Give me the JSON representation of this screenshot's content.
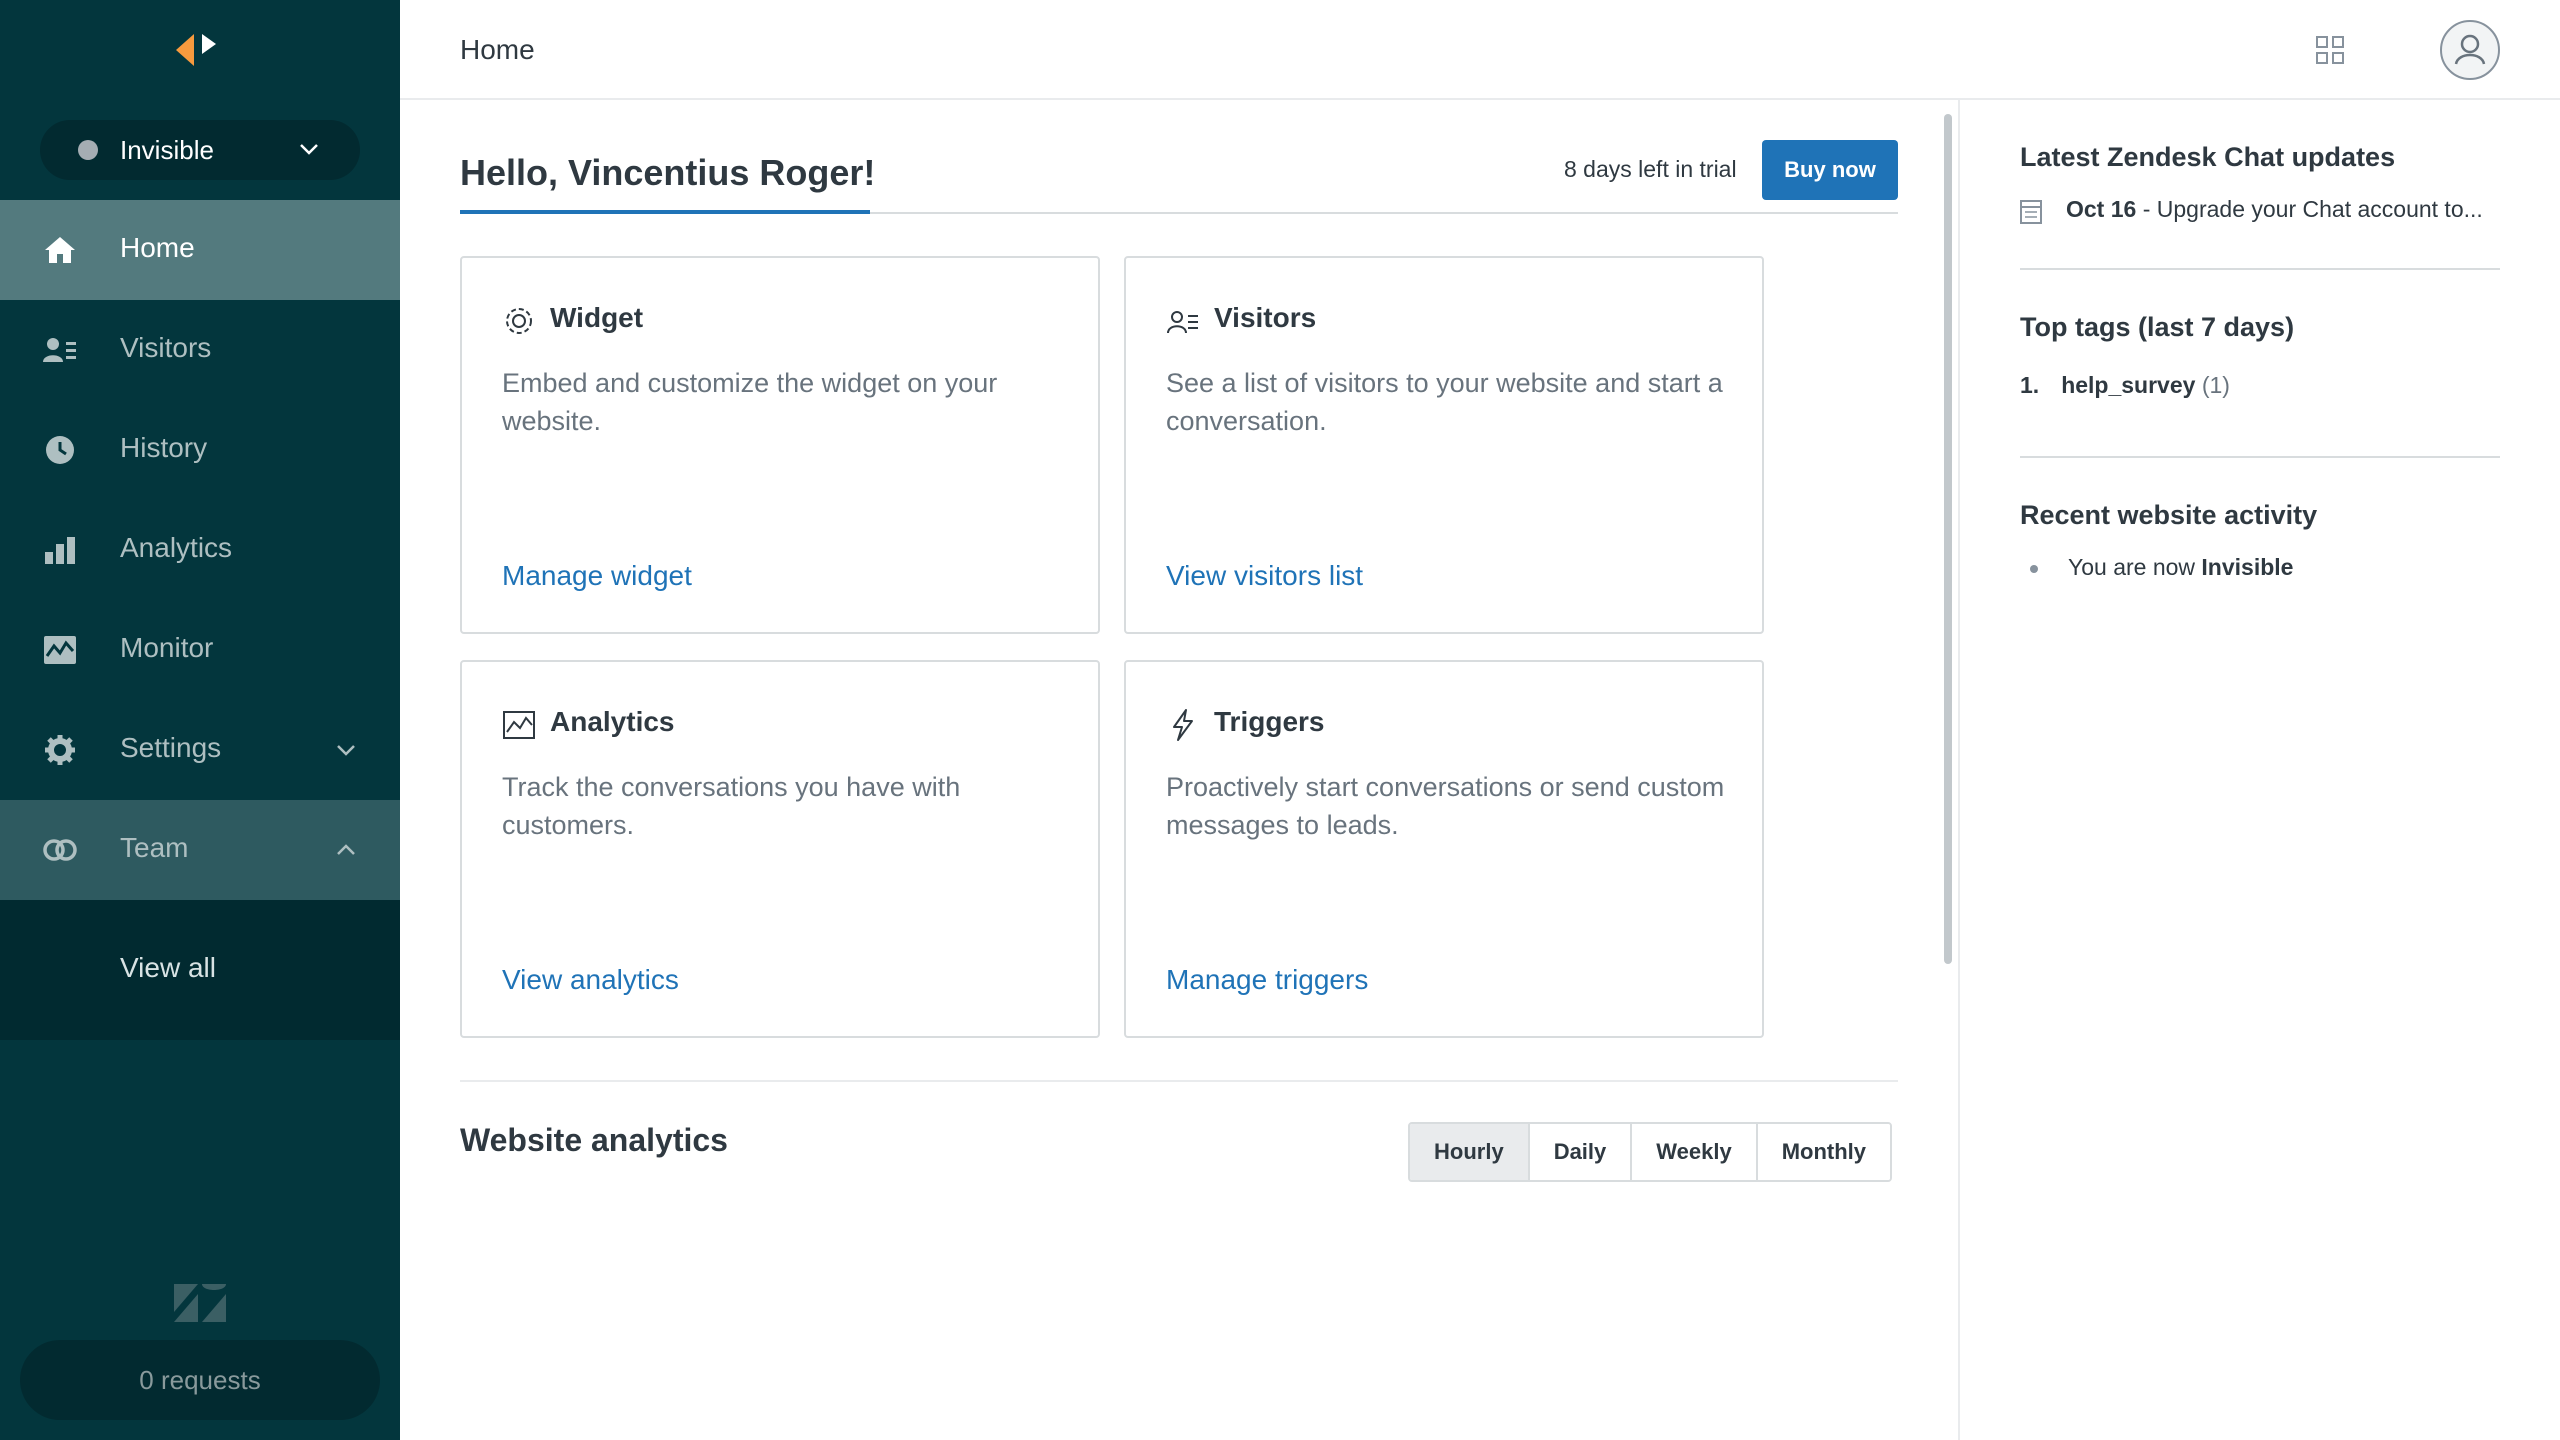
{
  "sidebar": {
    "status": "Invisible",
    "nav": [
      {
        "label": "Home",
        "icon": "home-icon"
      },
      {
        "label": "Visitors",
        "icon": "visitors-icon"
      },
      {
        "label": "History",
        "icon": "history-icon"
      },
      {
        "label": "Analytics",
        "icon": "analytics-icon"
      },
      {
        "label": "Monitor",
        "icon": "monitor-icon"
      },
      {
        "label": "Settings",
        "icon": "gear-icon"
      },
      {
        "label": "Team",
        "icon": "team-icon"
      }
    ],
    "team_sub": "View all",
    "requests": "0 requests"
  },
  "topbar": {
    "title": "Home"
  },
  "main": {
    "greeting": "Hello, Vincentius Roger!",
    "trial": "8 days left in trial",
    "buy": "Buy now",
    "cards": [
      {
        "title": "Widget",
        "desc": "Embed and customize the widget on your website.",
        "link": "Manage widget"
      },
      {
        "title": "Visitors",
        "desc": "See a list of visitors to your website and start a conversation.",
        "link": "View visitors list"
      },
      {
        "title": "Analytics",
        "desc": "Track the conversations you have with customers.",
        "link": "View analytics"
      },
      {
        "title": "Triggers",
        "desc": "Proactively start conversations or send custom messages to leads.",
        "link": "Manage triggers"
      }
    ],
    "website_analytics": "Website analytics",
    "ranges": [
      "Hourly",
      "Daily",
      "Weekly",
      "Monthly"
    ]
  },
  "right": {
    "updates_title": "Latest Zendesk Chat updates",
    "update_date": "Oct 16",
    "update_text": " - Upgrade your Chat account to...",
    "tags_title": "Top tags (last 7 days)",
    "tag_rank": "1.",
    "tag_name": "help_survey",
    "tag_count": "(1)",
    "activity_title": "Recent website activity",
    "activity_prefix": "You are now ",
    "activity_value": "Invisible"
  },
  "colors": {
    "sidebar": "#03363d",
    "active": "#537a7e",
    "accent": "#1f73b7",
    "logo_orange": "#f79a3e"
  }
}
